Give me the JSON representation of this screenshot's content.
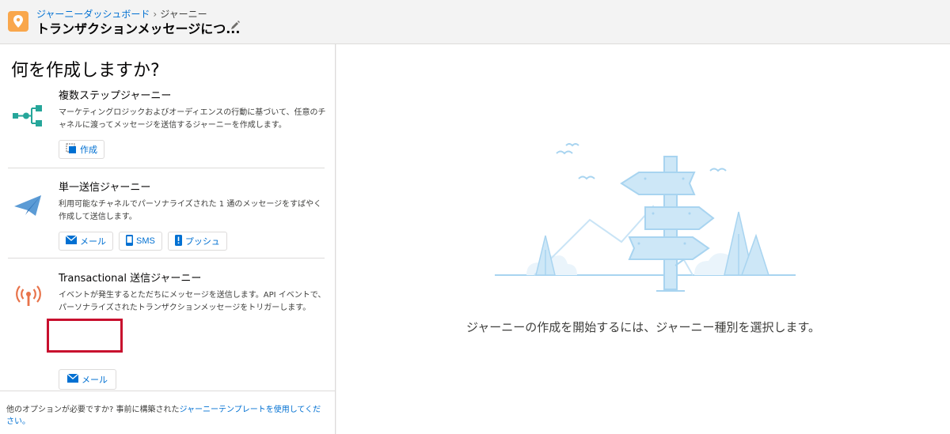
{
  "header": {
    "breadcrumb_parent": "ジャーニーダッシュボード",
    "breadcrumb_separator": "›",
    "breadcrumb_current": "ジャーニー",
    "title": "トランザクションメッセージにつ..."
  },
  "left_panel": {
    "heading": "何を作成しますか?",
    "options": [
      {
        "title": "複数ステップジャーニー",
        "description": "マーケティングロジックおよびオーディエンスの行動に基づいて、任意のチャネルに渡ってメッセージを送信するジャーニーを作成します。",
        "buttons": [
          {
            "label": "作成",
            "icon": "create-icon"
          }
        ]
      },
      {
        "title": "単一送信ジャーニー",
        "description": "利用可能なチャネルでパーソナライズされた 1 通のメッセージをすばやく作成して送信します。",
        "buttons": [
          {
            "label": "メール",
            "icon": "email-icon"
          },
          {
            "label": "SMS",
            "icon": "mobile-icon"
          },
          {
            "label": "プッシュ",
            "icon": "push-icon"
          }
        ]
      },
      {
        "title": "Transactional 送信ジャーニー",
        "description": "イベントが発生するとただちにメッセージを送信します。API イベントで、パーソナライズされたトランザクションメッセージをトリガーします。",
        "buttons": [
          {
            "label": "メール",
            "icon": "email-icon"
          }
        ]
      }
    ],
    "footer_text": "他のオプションが必要ですか? 事前に構築された",
    "footer_link": "ジャーニーテンプレートを使用してください。"
  },
  "right_panel": {
    "empty_message": "ジャーニーの作成を開始するには、ジャーニー種別を選択します。"
  },
  "colors": {
    "link": "#0070d2",
    "app_icon": "#f9a74c",
    "multi_step_icon": "#26a69a",
    "single_send_icon": "#5b9bd5",
    "transactional_icon": "#e8734a",
    "highlight": "#c8102e",
    "illustration": "#a8d4f0"
  }
}
